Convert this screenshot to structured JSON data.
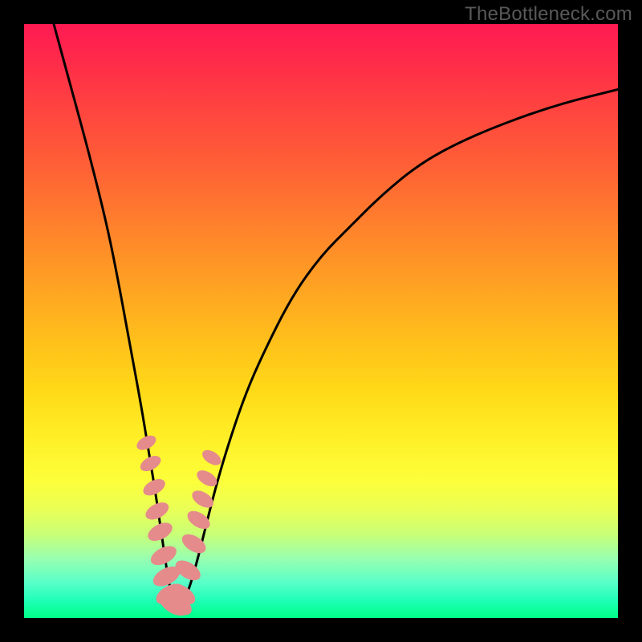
{
  "watermark": "TheBottleneck.com",
  "colors": {
    "frame": "#000000",
    "curve_stroke": "#000000",
    "marker_fill": "#e58b8c",
    "gradient_top": "#ff1a52",
    "gradient_bottom": "#00ff88"
  },
  "chart_data": {
    "type": "line",
    "title": "",
    "xlabel": "",
    "ylabel": "",
    "xlim": [
      0,
      100
    ],
    "ylim": [
      0,
      100
    ],
    "note": "The chart has no axis ticks or numeric labels in the image; values below are read off as 0–100 percentages of plot width (x) and plot height (y=0 at the bottom green band, y=100 at the top red band).",
    "series": [
      {
        "name": "curve",
        "style": "line",
        "x": [
          5,
          8,
          11,
          14,
          16,
          18,
          19.5,
          21,
          22.3,
          23.3,
          24.2,
          24.8,
          25.5,
          26.3,
          27.5,
          29,
          30.5,
          32,
          34,
          37,
          40,
          45,
          50,
          55,
          60,
          66,
          72,
          80,
          90,
          100
        ],
        "y": [
          100,
          89,
          78,
          66,
          56,
          45,
          37,
          28,
          20,
          13,
          7,
          4,
          2,
          2,
          4,
          9,
          15,
          21,
          28,
          37,
          44,
          54,
          61,
          66,
          71,
          76,
          79.5,
          83,
          86.5,
          89
        ]
      },
      {
        "name": "marker-cluster",
        "style": "scatter",
        "x": [
          20.6,
          21.3,
          21.9,
          22.4,
          22.9,
          23.5,
          24.0,
          24.6,
          25.2,
          25.9,
          26.6,
          27.6,
          28.6,
          29.4,
          30.1,
          30.8,
          31.6
        ],
        "y": [
          29.5,
          26.0,
          22.0,
          18.0,
          14.5,
          10.5,
          7.0,
          4.0,
          2.3,
          2.3,
          4.0,
          8.0,
          12.5,
          16.5,
          20.0,
          23.5,
          27.0
        ]
      }
    ]
  }
}
